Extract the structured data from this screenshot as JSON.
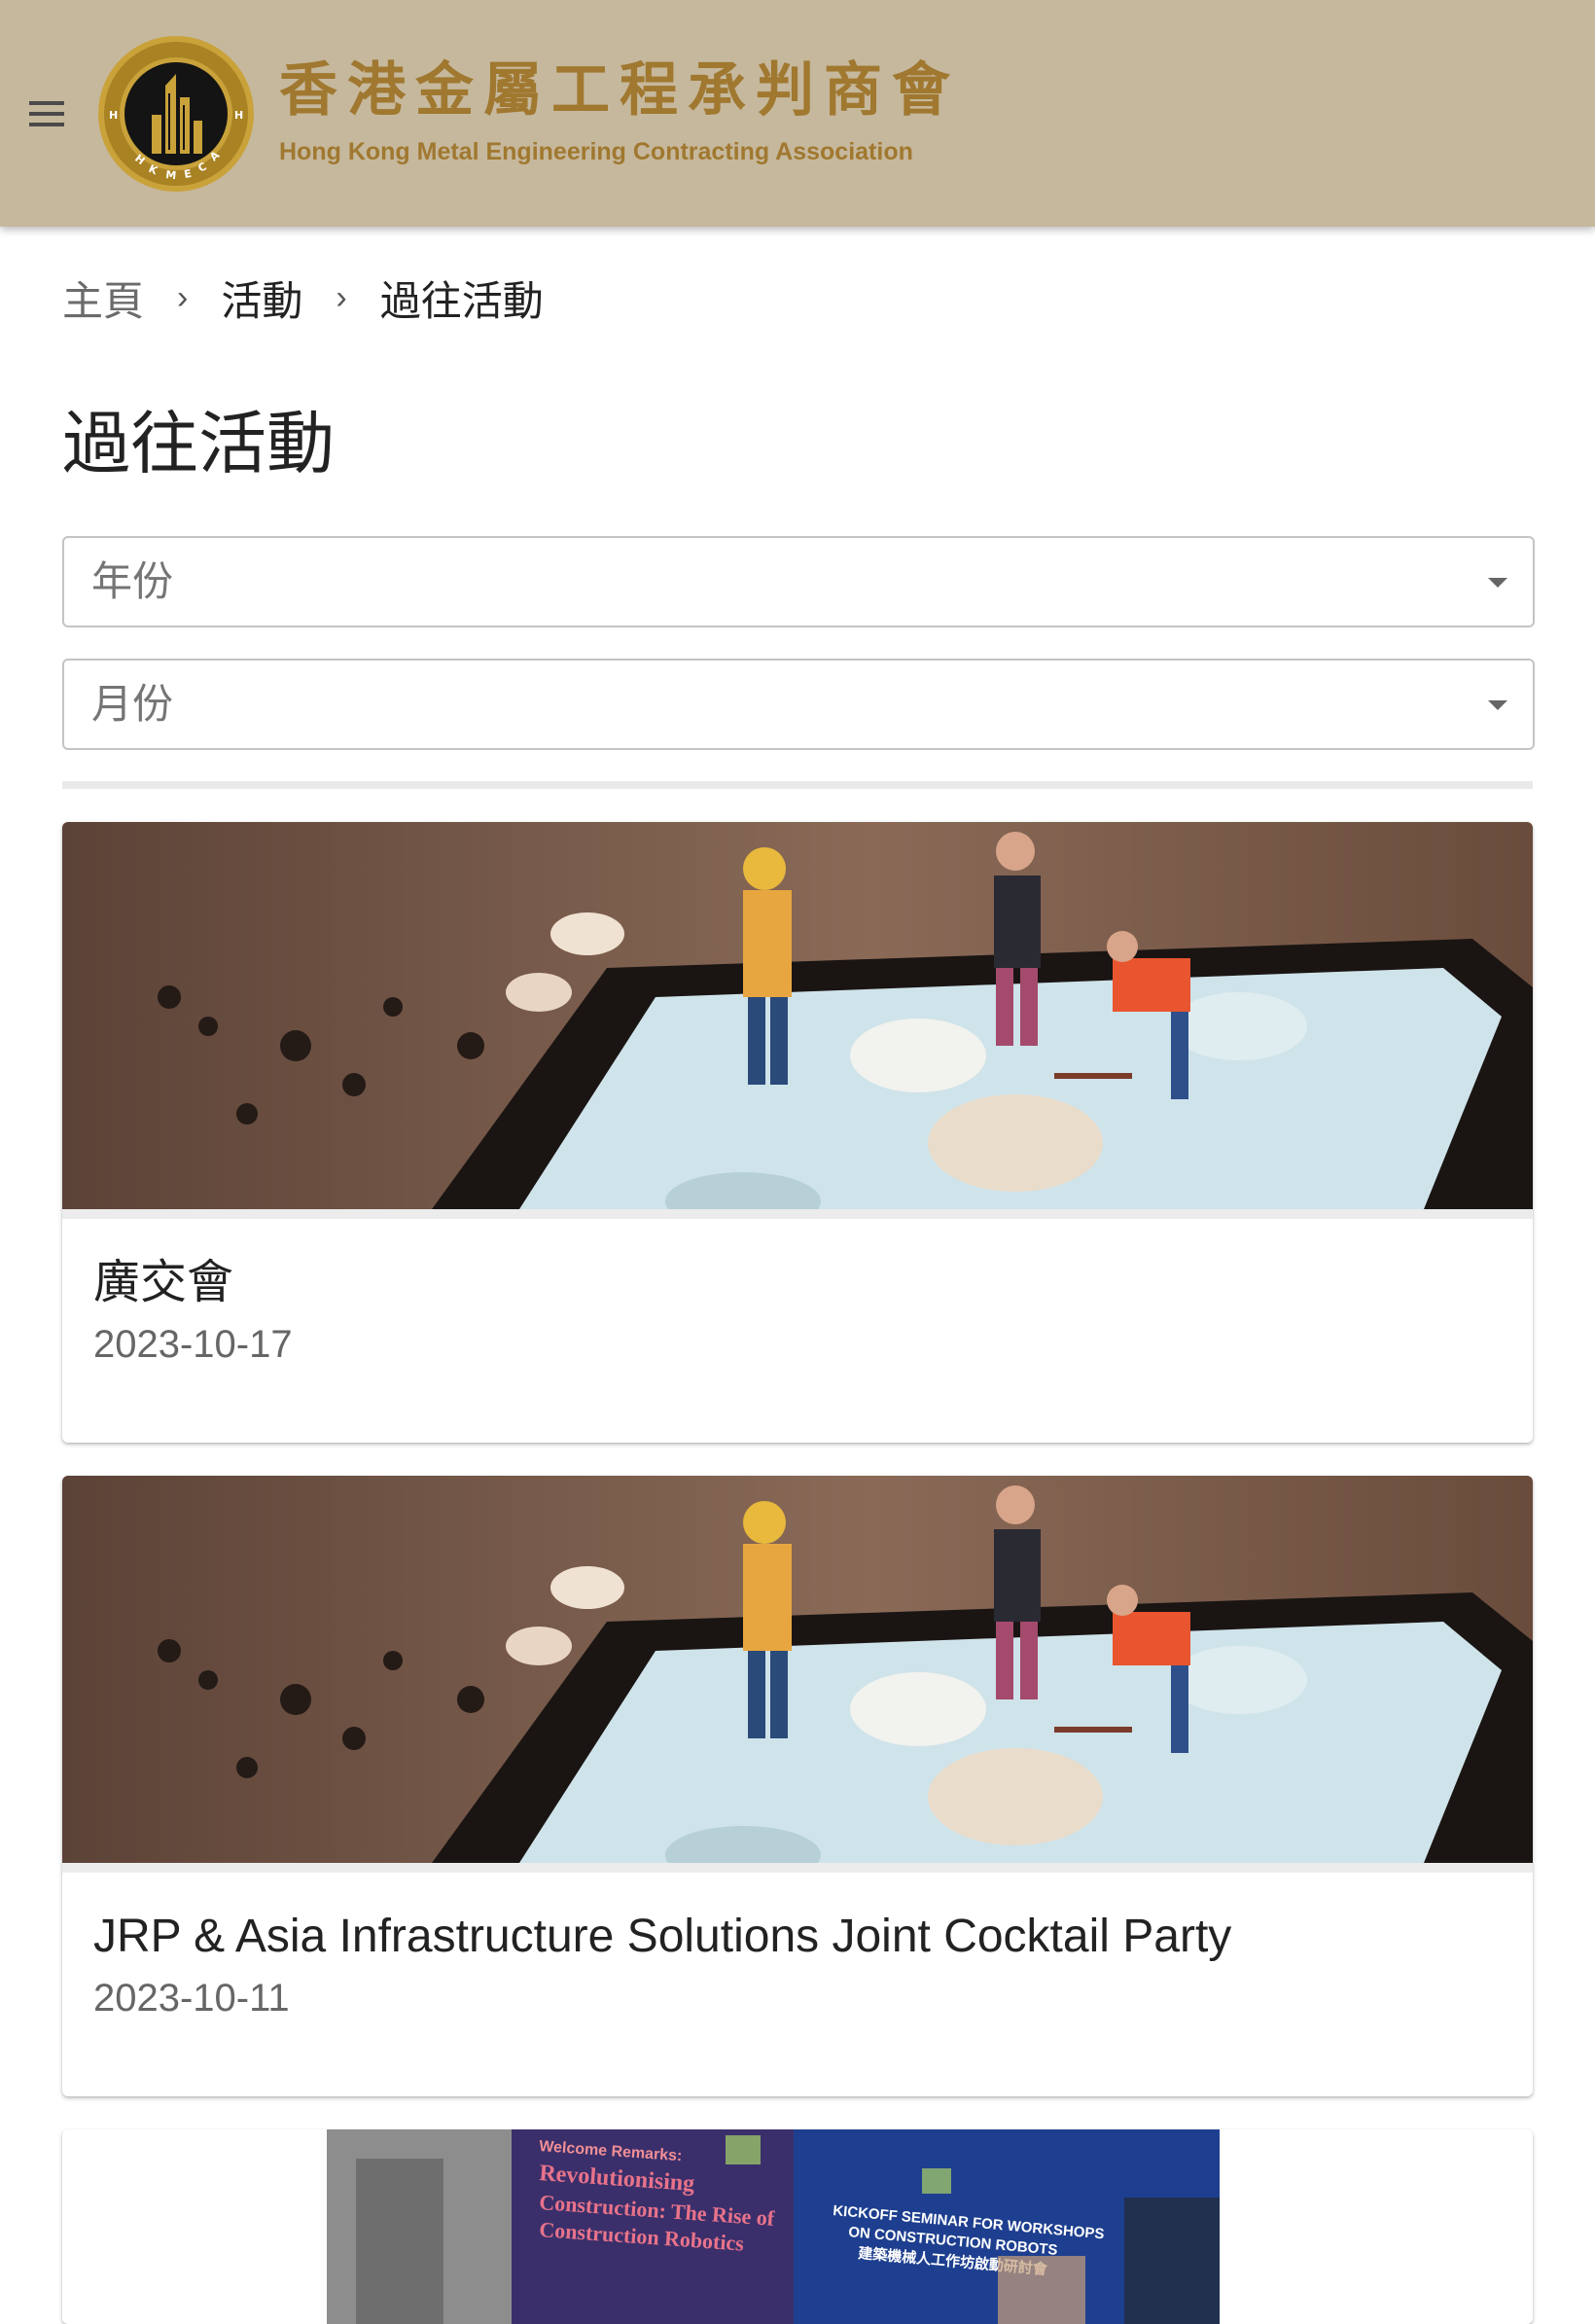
{
  "header": {
    "menu_icon": "hamburger-menu-icon",
    "logo_letters": "HKMECA",
    "title_cn": "香港金屬工程承判商會",
    "title_en": "Hong Kong Metal Engineering Contracting Association",
    "background_color": "#c6b89d",
    "brand_color": "#a0782f"
  },
  "breadcrumb": {
    "items": [
      "主頁",
      "活動",
      "過往活動"
    ],
    "separator_icon": "chevron-right-icon"
  },
  "page": {
    "title": "過往活動"
  },
  "filters": {
    "year_label": "年份",
    "month_label": "月份",
    "dropdown_icon": "dropdown-arrow-icon"
  },
  "events": [
    {
      "title": "廣交會",
      "date": "2023-10-17",
      "image": "miniature-construction-workers-photo"
    },
    {
      "title": "JRP & Asia Infrastructure Solutions Joint Cocktail Party",
      "date": "2023-10-11",
      "image": "miniature-construction-workers-photo"
    },
    {
      "image": "seminar-stage-photo",
      "poster_text": {
        "welcome": "Welcome Remarks:",
        "line1": "Revolutionising",
        "line2": "Construction: The Rise of",
        "line3": "Construction Robotics",
        "kickoff": "KICKOFF SEMINAR FOR WORKSHOPS",
        "robots": "ON CONSTRUCTION ROBOTS",
        "cn": "建築機械人工作坊啟動研討會"
      }
    }
  ]
}
